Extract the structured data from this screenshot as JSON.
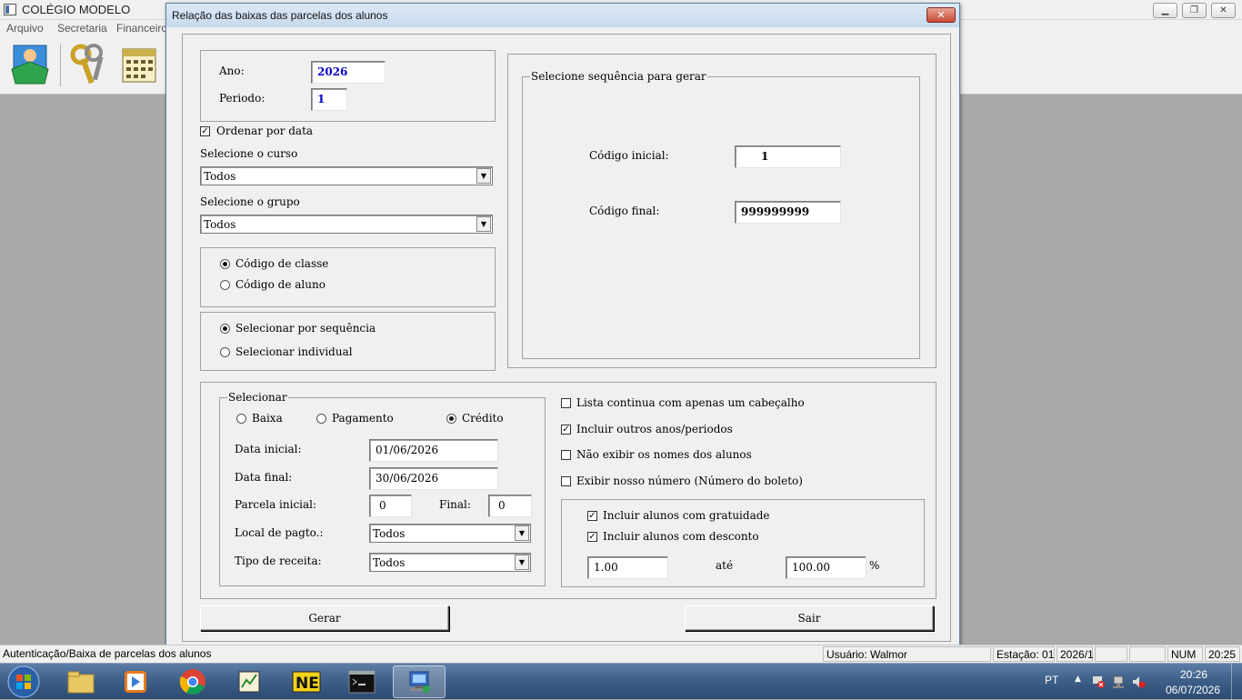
{
  "app": {
    "title": "COLÉGIO MODELO",
    "menu": [
      "Arquivo",
      "Secretaria",
      "Financeiro"
    ],
    "toolbar_icons": [
      "student-icon",
      "keys-icon",
      "calendar-icon"
    ]
  },
  "dialog": {
    "title": "Relação das baixas das parcelas dos alunos",
    "close_label": "✕",
    "ano_label": "Ano:",
    "ano_value": "2026",
    "periodo_label": "Periodo:",
    "periodo_value": "1",
    "ordenar_label": "Ordenar por data",
    "ordenar_checked": true,
    "curso_label": "Selecione o curso",
    "curso_value": "Todos",
    "grupo_label": "Selecione o grupo",
    "grupo_value": "Todos",
    "codigo_classe_label": "Código de classe",
    "codigo_aluno_label": "Código de aluno",
    "codigo_selected": "classe",
    "sel_sequencia_label": "Selecionar por sequência",
    "sel_individual_label": "Selecionar individual",
    "sel_selected": "sequencia",
    "sequencia_group_label": "Selecione sequência para gerar",
    "codigo_inicial_label": "Código inicial:",
    "codigo_inicial_value": "1",
    "codigo_final_label": "Código final:",
    "codigo_final_value": "999999999",
    "selecionar_group_label": "Selecionar",
    "baixa_label": "Baixa",
    "pagamento_label": "Pagamento",
    "credito_label": "Crédito",
    "selecionar_selected": "credito",
    "data_inicial_label": "Data inicial:",
    "data_inicial_value": "01/06/2026",
    "data_final_label": "Data final:",
    "data_final_value": "30/06/2026",
    "parcela_inicial_label": "Parcela inicial:",
    "parcela_inicial_value": "0",
    "final_label": "Final:",
    "final_value": "0",
    "local_pagto_label": "Local de pagto.:",
    "local_pagto_value": "Todos",
    "tipo_receita_label": "Tipo de receita:",
    "tipo_receita_value": "Todos",
    "lista_continua_label": "Lista continua com apenas um cabeçalho",
    "lista_continua_checked": false,
    "incluir_outros_label": "Incluir outros anos/periodos",
    "incluir_outros_checked": true,
    "nao_exibir_label": "Não exibir os nomes dos alunos",
    "nao_exibir_checked": false,
    "exibir_nosso_label": "Exibir nosso número (Número do boleto)",
    "exibir_nosso_checked": false,
    "gratuidade_label": "Incluir alunos com gratuidade",
    "gratuidade_checked": true,
    "desconto_label": "Incluir alunos com desconto",
    "desconto_checked": true,
    "desconto_min": "1.00",
    "ate_label": "até",
    "desconto_max": "100.00",
    "percent_label": "%",
    "gerar_label": "Gerar",
    "sair_label": "Sair"
  },
  "statusbar": {
    "message": "Autenticação/Baixa de parcelas dos alunos",
    "usuario": "Usuário: Walmor",
    "estacao": "Estação: 01",
    "periodo": "2026/1",
    "num": "NUM",
    "time": "20:25"
  },
  "taskbar": {
    "language": "PT",
    "clock_time": "20:26",
    "clock_date": "06/07/2026",
    "apps": [
      "file-explorer-icon",
      "media-player-icon",
      "chrome-icon",
      "chart-editor-icon",
      "ne-app-icon",
      "command-prompt-icon",
      "network-app-icon"
    ]
  },
  "colors": {
    "accent_value_blue": "#0000cc",
    "dialog_title_bg": "#c7d9ee",
    "close_red": "#c74a36",
    "taskbar": "#3e6089"
  }
}
